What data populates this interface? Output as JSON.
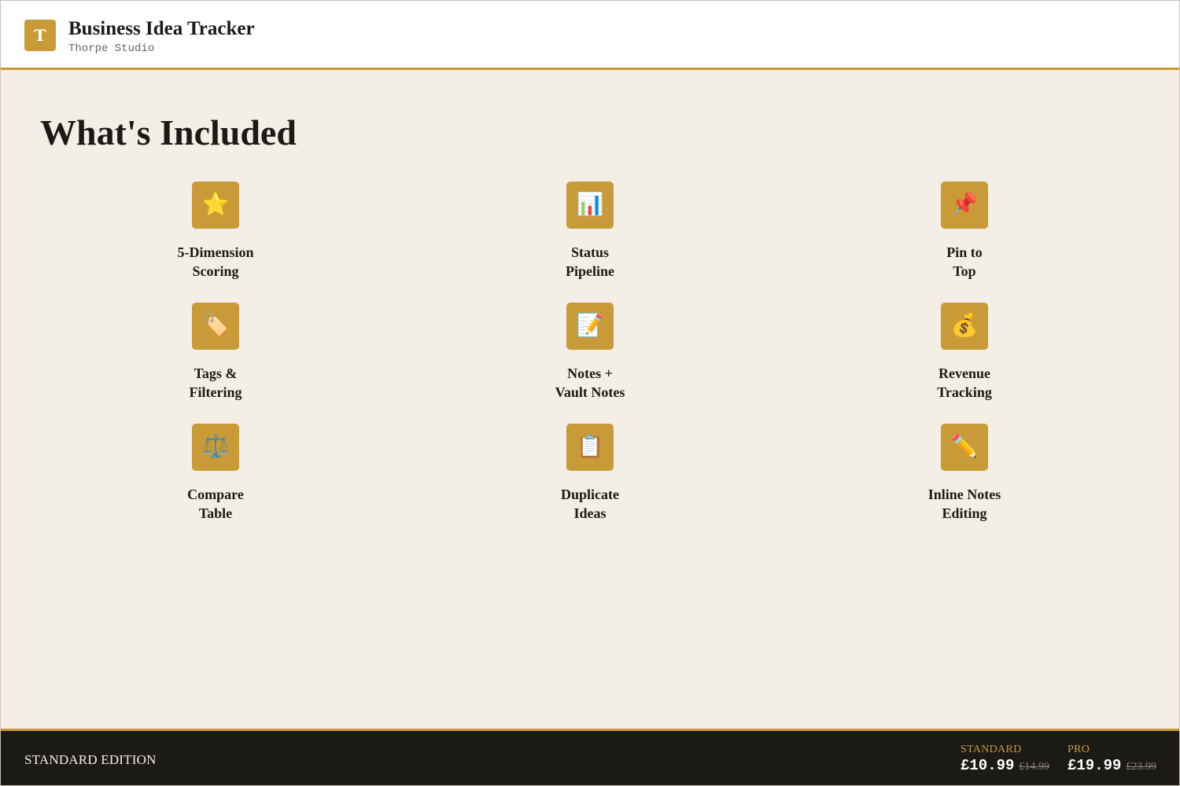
{
  "header": {
    "logo_letter": "T",
    "title": "Business Idea Tracker",
    "subtitle": "Thorpe Studio"
  },
  "main": {
    "section_title": "What's Included",
    "features": [
      {
        "icon": "star-icon",
        "glyph": "⭐",
        "line1": "5-Dimension",
        "line2": "Scoring"
      },
      {
        "icon": "bar-chart-icon",
        "glyph": "📊",
        "line1": "Status",
        "line2": "Pipeline"
      },
      {
        "icon": "pushpin-icon",
        "glyph": "📌",
        "line1": "Pin to",
        "line2": "Top"
      },
      {
        "icon": "tag-icon",
        "glyph": "🏷️",
        "line1": "Tags &",
        "line2": "Filtering"
      },
      {
        "icon": "memo-icon",
        "glyph": "📝",
        "line1": "Notes +",
        "line2": "Vault Notes"
      },
      {
        "icon": "money-bag-icon",
        "glyph": "💰",
        "line1": "Revenue",
        "line2": "Tracking"
      },
      {
        "icon": "balance-scale-icon",
        "glyph": "⚖️",
        "line1": "Compare",
        "line2": "Table"
      },
      {
        "icon": "clipboard-icon",
        "glyph": "📋",
        "line1": "Duplicate",
        "line2": "Ideas"
      },
      {
        "icon": "pencil-icon",
        "glyph": "✏️",
        "line1": "Inline Notes",
        "line2": "Editing"
      }
    ]
  },
  "footer": {
    "edition": "STANDARD EDITION",
    "tiers": [
      {
        "name": "STANDARD",
        "price": "£10.99",
        "old_price": "£14.99"
      },
      {
        "name": "PRO",
        "price": "£19.99",
        "old_price": "£23.99"
      }
    ]
  },
  "colors": {
    "accent": "#c99a38",
    "background": "#f4efe6",
    "footer_background": "#1c1a16",
    "text": "#1c1a16"
  }
}
